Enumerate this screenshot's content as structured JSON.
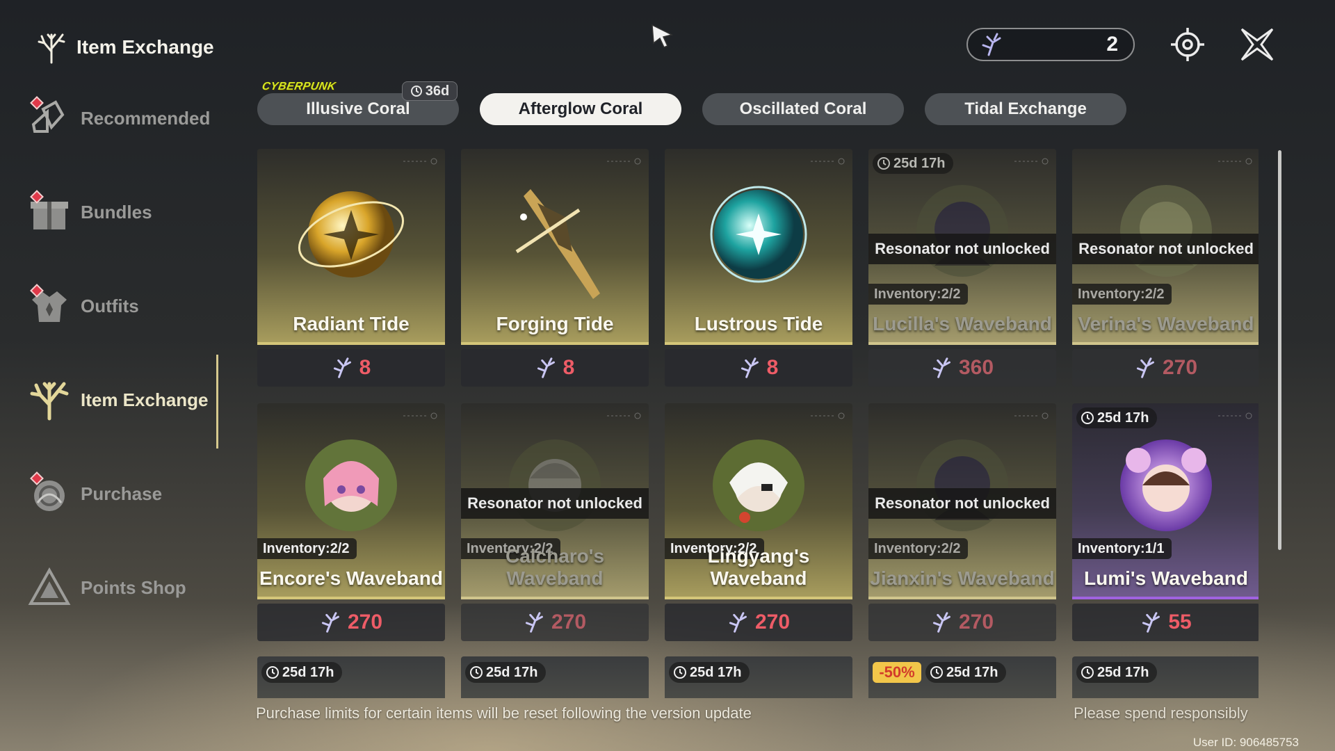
{
  "app": {
    "title": "Item Exchange"
  },
  "sidebar": {
    "items": [
      {
        "label": "Recommended",
        "icon": "recommended-icon",
        "active": false,
        "alert": true
      },
      {
        "label": "Bundles",
        "icon": "gift-icon",
        "active": false,
        "alert": true
      },
      {
        "label": "Outfits",
        "icon": "outfit-icon",
        "active": false,
        "alert": true
      },
      {
        "label": "Item Exchange",
        "icon": "coral-icon",
        "active": true,
        "alert": false
      },
      {
        "label": "Purchase",
        "icon": "purchase-icon",
        "active": false,
        "alert": true
      },
      {
        "label": "Points Shop",
        "icon": "points-shop-icon",
        "active": false,
        "alert": false
      }
    ]
  },
  "header": {
    "currency": {
      "icon": "afterglow-coral-icon",
      "value": "2"
    },
    "buttons": [
      "settings-icon",
      "close-icon"
    ]
  },
  "tabs": [
    {
      "label": "Illusive Coral",
      "badge": "36d",
      "logo": "CYBERPUNK",
      "selected": false
    },
    {
      "label": "Afterglow Coral",
      "selected": true
    },
    {
      "label": "Oscillated Coral",
      "selected": false
    },
    {
      "label": "Tidal Exchange",
      "selected": false
    }
  ],
  "lock_text": "Resonator not unlocked",
  "inventory_label": "Inventory:",
  "items": [
    {
      "name": "Radiant Tide",
      "price": "8",
      "locked": false,
      "art": "gold-orb"
    },
    {
      "name": "Forging Tide",
      "price": "8",
      "locked": false,
      "art": "forge"
    },
    {
      "name": "Lustrous Tide",
      "price": "8",
      "locked": false,
      "art": "teal-orb"
    },
    {
      "name": "Lucilla's Waveband",
      "price": "360",
      "locked": true,
      "timer": "25d 17h",
      "inventory": "2/2",
      "art": "portrait-dark"
    },
    {
      "name": "Verina's Waveband",
      "price": "270",
      "locked": true,
      "inventory": "2/2",
      "art": "portrait-green"
    },
    {
      "name": "Encore's Waveband",
      "price": "270",
      "locked": false,
      "inventory": "2/2",
      "art": "portrait-pink"
    },
    {
      "name": "Calcharo's Waveband",
      "price": "270",
      "locked": true,
      "inventory": "2/2",
      "art": "portrait-grey"
    },
    {
      "name": "Lingyang's Waveband",
      "price": "270",
      "locked": false,
      "inventory": "2/2",
      "art": "portrait-white"
    },
    {
      "name": "Jianxin's Waveband",
      "price": "270",
      "locked": true,
      "inventory": "2/2",
      "art": "portrait-dark"
    },
    {
      "name": "Lumi's Waveband",
      "price": "55",
      "locked": false,
      "timer": "25d 17h",
      "inventory": "1/1",
      "art": "portrait-purple",
      "rarity": "purple"
    }
  ],
  "bottom_row": [
    {
      "timer": "25d 17h"
    },
    {
      "timer": "25d 17h"
    },
    {
      "timer": "25d 17h"
    },
    {
      "timer": "25d 17h",
      "discount": "-50%"
    },
    {
      "timer": "25d 17h"
    }
  ],
  "footer": {
    "note": "Purchase limits for certain items will be reset following the version update",
    "warning": "Please spend responsibly",
    "user_id": "User ID: 906485753"
  },
  "colors": {
    "price_red": "#ee5c67",
    "accent_gold": "#d4c679",
    "purple_rarity": "#a063e0"
  }
}
